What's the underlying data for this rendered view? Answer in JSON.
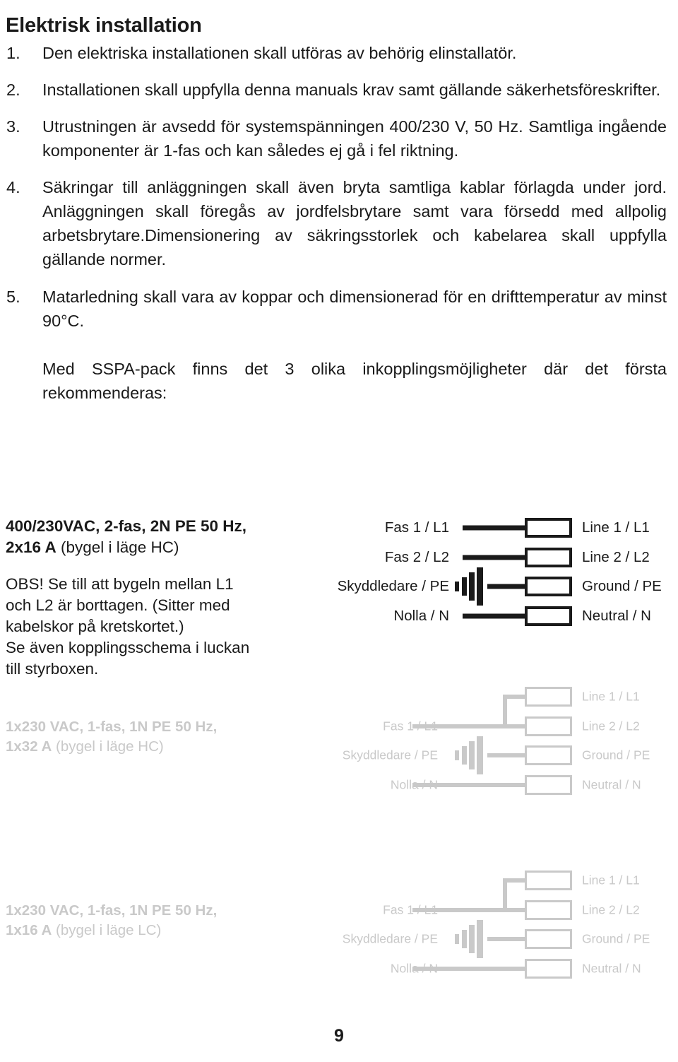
{
  "document": {
    "title": "Elektrisk installation",
    "page_number": "9"
  },
  "instructions": [
    {
      "marker": "1.",
      "text": "Den elektriska installationen skall utföras av behörig elinstallatör."
    },
    {
      "marker": "2.",
      "text": "Installationen skall uppfylla denna manuals krav samt gällande säkerhetsföreskrifter."
    },
    {
      "marker": "3.",
      "text": "Utrustningen är avsedd för systemspänningen 400/230 V, 50 Hz. Samtliga ingående komponenter är 1-fas och kan således ej gå i fel riktning."
    },
    {
      "marker": "4.",
      "text": "Säkringar till anläggningen skall även bryta samtliga kablar förlagda under jord. Anläggningen skall föregås av jordfelsbrytare samt vara försedd med allpolig arbetsbrytare.Dimensionering av säkringsstorlek och kabelarea skall uppfylla gällande normer."
    },
    {
      "marker": "5.",
      "text": "Matarledning skall vara av koppar och dimensionerad för en drifttemperatur av minst 90°C."
    }
  ],
  "intro_paragraph": "Med SSPA-pack finns det 3 olika inkopplingsmöjligheter där det första rekommenderas:",
  "wiring_options": [
    {
      "id": "option-1",
      "active": true,
      "color": "#1a1a1a",
      "caption_bold_1": "400/230VAC, 2-fas, 2N PE 50 Hz,",
      "caption_bold_2": "2x16 A",
      "caption_normal_2": " (bygel i läge HC)",
      "note": "OBS! Se till att bygeln mellan L1 och L2 är borttagen. (Sitter med kabelskor på kretskortet.)\nSe även kopplingsschema i luckan till styrboxen.",
      "note_lines": [
        "OBS! Se till att bygeln mellan L1",
        "och L2 är borttagen. (Sitter med",
        "kabelskor på kretskortet.)",
        "Se även kopplingsschema i luckan",
        "till styrboxen."
      ],
      "jumper": false,
      "rows": [
        {
          "left": "Fas 1 / L1",
          "right": "Line 1 / L1",
          "wire": true,
          "ground": false
        },
        {
          "left": "Fas 2 / L2",
          "right": "Line 2 / L2",
          "wire": true,
          "ground": false
        },
        {
          "left": "Skyddledare / PE",
          "right": "Ground / PE",
          "wire": true,
          "ground": true
        },
        {
          "left": "Nolla / N",
          "right": "Neutral / N",
          "wire": true,
          "ground": false
        }
      ]
    },
    {
      "id": "option-2",
      "active": false,
      "color": "#c9c9c9",
      "caption_bold_1": "1x230 VAC, 1-fas, 1N PE 50 Hz,",
      "caption_bold_2": "1x32 A",
      "caption_normal_2": " (bygel i läge HC)",
      "jumper": true,
      "rows": [
        {
          "left": "",
          "right": "Line 1 / L1",
          "wire": false,
          "ground": false
        },
        {
          "left": "Fas 1 / L1",
          "right": "Line 2 / L2",
          "wire": true,
          "ground": false
        },
        {
          "left": "Skyddledare / PE",
          "right": "Ground / PE",
          "wire": true,
          "ground": true
        },
        {
          "left": "Nolla / N",
          "right": "Neutral / N",
          "wire": true,
          "ground": false
        }
      ]
    },
    {
      "id": "option-3",
      "active": false,
      "color": "#c9c9c9",
      "caption_bold_1": "1x230 VAC, 1-fas, 1N PE 50 Hz,",
      "caption_bold_2": "1x16 A",
      "caption_normal_2": " (bygel i läge LC)",
      "jumper": true,
      "rows": [
        {
          "left": "",
          "right": "Line 1 / L1",
          "wire": false,
          "ground": false
        },
        {
          "left": "Fas 1 / L1",
          "right": "Line 2 / L2",
          "wire": true,
          "ground": false
        },
        {
          "left": "Skyddledare / PE",
          "right": "Ground / PE",
          "wire": true,
          "ground": true
        },
        {
          "left": "Nolla / N",
          "right": "Neutral / N",
          "wire": true,
          "ground": false
        }
      ]
    }
  ]
}
